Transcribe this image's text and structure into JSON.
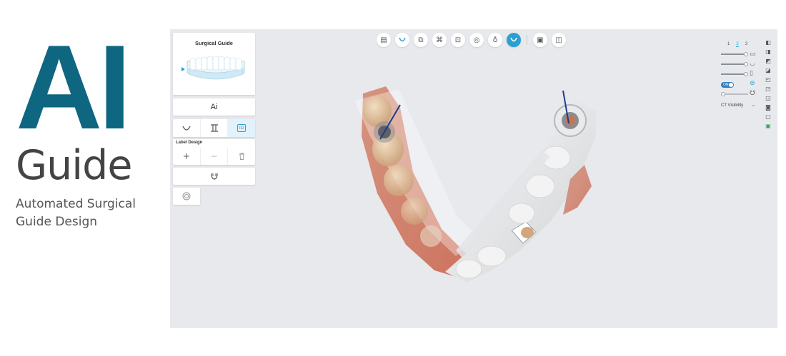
{
  "brand": {
    "ai": "AI",
    "guide": "Guide",
    "subtitle_line1": "Automated Surgical",
    "subtitle_line2": "Guide Design",
    "color": "#0e6680"
  },
  "left_panel": {
    "surgical_guide_title": "Surgical Guide",
    "ai_button": "Ai",
    "tools": [
      "upper-jaw-icon",
      "implant-post-icon",
      "id-label-icon"
    ],
    "id_tool_label": "ID",
    "label_design_title": "Label Design",
    "label_tools": [
      "+",
      "−",
      "trash-icon"
    ],
    "guide_tool": "guide-icon",
    "settings_tool": "target-icon"
  },
  "top_toolbar": {
    "icons": [
      "report-icon",
      "arch-icon",
      "scan-icon",
      "teeth-icon",
      "crown-icon",
      "tooth-view-icon",
      "implant-icon",
      "guide-active-icon",
      "clipboard-icon",
      "save-icon"
    ],
    "accent": "#29a0d4"
  },
  "right_panel": {
    "tabs": [
      "1",
      "2",
      "3"
    ],
    "active_tab": "2",
    "sliders": [
      0.9,
      0.9,
      0.9
    ],
    "toggle_label": "ON",
    "ct_visibility_label": "CT Visibility",
    "ct_slider": 0.05
  }
}
